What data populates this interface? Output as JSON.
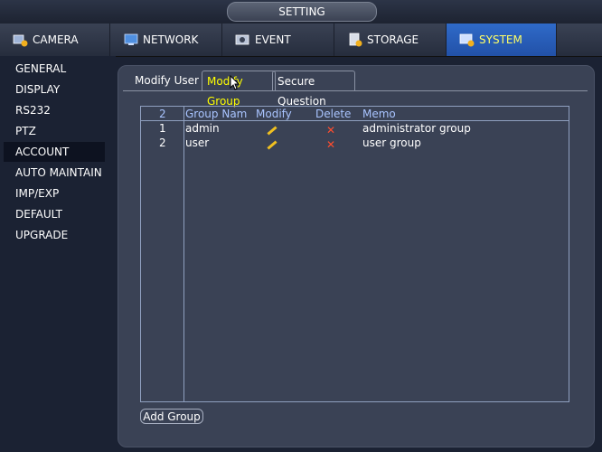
{
  "title": "SETTING",
  "topnav": [
    {
      "label": "CAMERA",
      "icon": "camera-icon"
    },
    {
      "label": "NETWORK",
      "icon": "network-icon"
    },
    {
      "label": "EVENT",
      "icon": "event-icon"
    },
    {
      "label": "STORAGE",
      "icon": "storage-icon"
    },
    {
      "label": "SYSTEM",
      "icon": "system-icon",
      "active": true
    }
  ],
  "sidebar": {
    "items": [
      "GENERAL",
      "DISPLAY",
      "RS232",
      "PTZ",
      "ACCOUNT",
      "AUTO MAINTAIN",
      "IMP/EXP",
      "DEFAULT",
      "UPGRADE"
    ],
    "active": "ACCOUNT"
  },
  "subtabs": {
    "items": [
      "Modify User",
      "Modify Group",
      "Secure Question"
    ],
    "active": "Modify Group"
  },
  "table": {
    "count": "2",
    "headers": {
      "name": "Group Nam",
      "modify": "Modify",
      "delete": "Delete",
      "memo": "Memo"
    },
    "rows": [
      {
        "index": "1",
        "name": "admin",
        "memo": "administrator group"
      },
      {
        "index": "2",
        "name": "user",
        "memo": "user group"
      }
    ]
  },
  "buttons": {
    "add_group": "Add Group"
  },
  "colors": {
    "accent": "#2f6ac8",
    "active_text": "#ffff00",
    "header_text": "#a9c4ff",
    "delete": "#ff4d2e",
    "modify": "#f0c020"
  }
}
